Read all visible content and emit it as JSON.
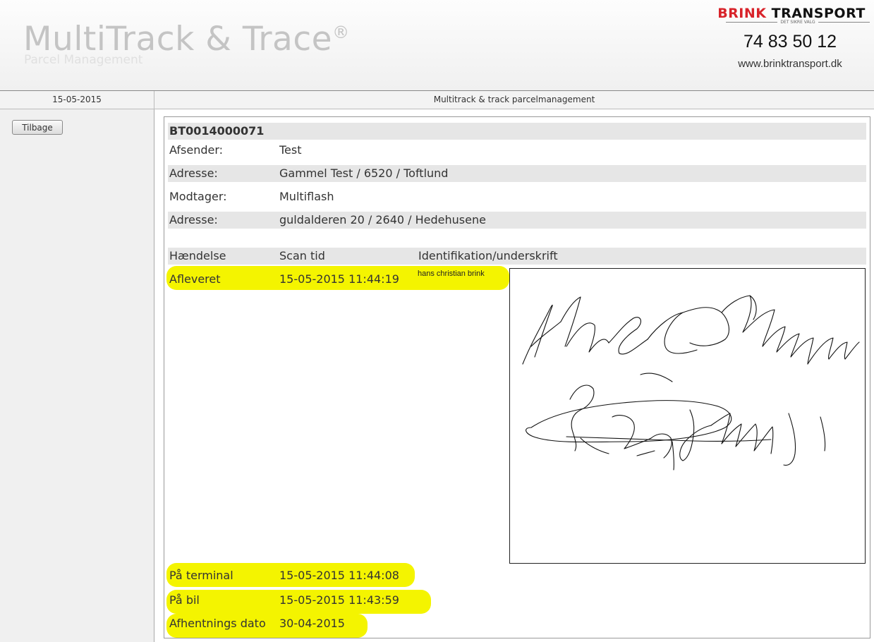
{
  "header": {
    "app_title": "MultiTrack & Trace",
    "trademark": "®",
    "app_subtitle": "Parcel Management",
    "brand_left": "BRINK",
    "brand_right": " TRANSPORT",
    "brand_tagline": "DET SIKRE VALG",
    "phone": "74 83 50 12",
    "website": "www.brinktransport.dk"
  },
  "subheader": {
    "date": "15-05-2015",
    "title": "Multitrack & track parcelmanagement"
  },
  "sidebar": {
    "back_label": "Tilbage"
  },
  "shipment": {
    "id": "BT0014000071",
    "fields": [
      {
        "label": "Afsender:",
        "value": "Test"
      },
      {
        "label": "Adresse:",
        "value": "Gammel Test / 6520 / Toftlund"
      },
      {
        "label": "Modtager:",
        "value": "Multiflash"
      },
      {
        "label": "Adresse:",
        "value": "guldalderen 20 / 2640 / Hedehusene"
      }
    ]
  },
  "events": {
    "columns": [
      "Hændelse",
      "Scan tid",
      "Identifikation/underskrift"
    ],
    "delivered": {
      "event": "Afleveret",
      "time": "15-05-2015 11:44:19",
      "signer": "hans christian brink"
    },
    "history": [
      {
        "event": "På terminal",
        "time": "15-05-2015 11:44:08"
      },
      {
        "event": "På bil",
        "time": "15-05-2015 11:43:59"
      },
      {
        "event": "Afhentnings dato",
        "time": "30-04-2015"
      }
    ]
  },
  "colors": {
    "highlight": "#f4f400",
    "brand_red": "#d8232a",
    "row_gray": "#e6e6e6"
  }
}
